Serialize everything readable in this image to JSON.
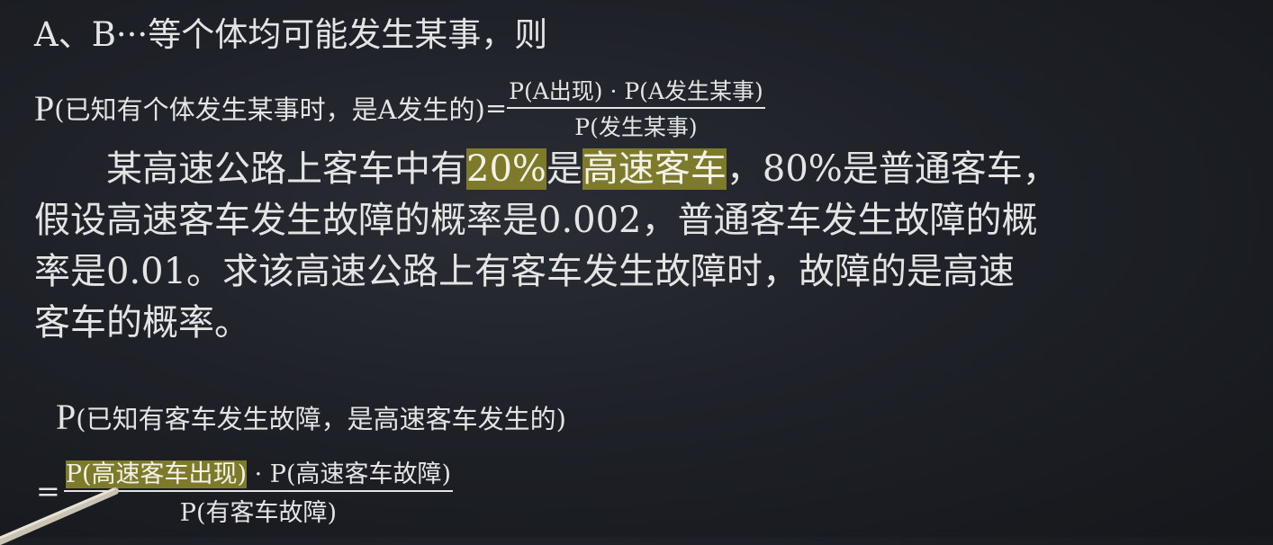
{
  "rule": {
    "intro": "A、B···等个体均可能发生某事，则",
    "p": "P",
    "condition": "(已知有个体发生某事时，是A发生的)",
    "equals": "=",
    "numerator": "P(A出现) · P(A发生某事)",
    "denominator": "P(发生某事)"
  },
  "problem": {
    "line1_a": "某高速公路上客车中有",
    "line1_hl1": "20%",
    "line1_b": "是",
    "line1_hl2": "高速客车",
    "line1_c": "，80%是普通客车，",
    "line2": "假设高速客车发生故障的概率是0.002，普通客车发生故障的概",
    "line3": "率是0.01。求该高速公路上有客车发生故障时，故障的是高速",
    "line4": "客车的概率。"
  },
  "solution": {
    "p": "P",
    "condition": "(已知有客车发生故障，是高速客车发生的)",
    "equals": "=",
    "numerator_hl": "P(高速客车出现)",
    "numerator_rest": " · P(高速客车故障)",
    "denominator": "P(有客车故障)"
  }
}
